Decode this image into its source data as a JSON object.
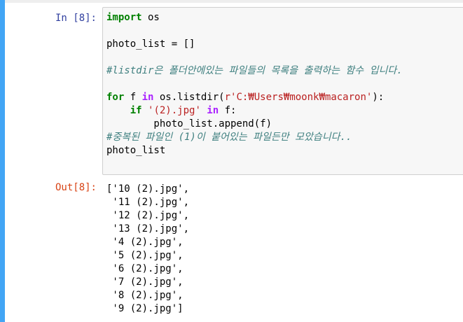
{
  "in_cell": {
    "prompt": "In [8]:",
    "code": {
      "import_kw": "import",
      "import_mod": " os",
      "photo_list_decl": "photo_list = ",
      "empty_list": "[]",
      "comment1": "#listdir은 폴더안에있는 파일들의 목록을 출력하는 함수 입니다.",
      "for_kw": "for",
      "for_var": " f ",
      "in_kw": "in",
      "for_call_pre": " os.listdir(",
      "path_str": "r'C:₩Users₩moonk₩macaron'",
      "for_call_post": "):",
      "indent1": "    ",
      "if_kw": "if",
      "if_space": " ",
      "match_str": "'(2).jpg'",
      "in_kw2": " in",
      "if_tail": " f:",
      "append_line": "        photo_list.append(f)",
      "comment2": "#중복된 파일인 (1)이 붙어있는 파일든만 모았습니다..",
      "last_line": "photo_list"
    }
  },
  "out_cell": {
    "prompt": "Out[8]:",
    "lines": [
      "['10 (2).jpg',",
      " '11 (2).jpg',",
      " '12 (2).jpg',",
      " '13 (2).jpg',",
      " '4 (2).jpg',",
      " '5 (2).jpg',",
      " '6 (2).jpg',",
      " '7 (2).jpg',",
      " '8 (2).jpg',",
      " '9 (2).jpg']"
    ]
  },
  "colors": {
    "cell_border": "#42a5f5",
    "in_prompt": "#303f9f",
    "out_prompt": "#d84315",
    "keyword": "#008000",
    "string": "#ba2121",
    "comment": "#408080"
  }
}
